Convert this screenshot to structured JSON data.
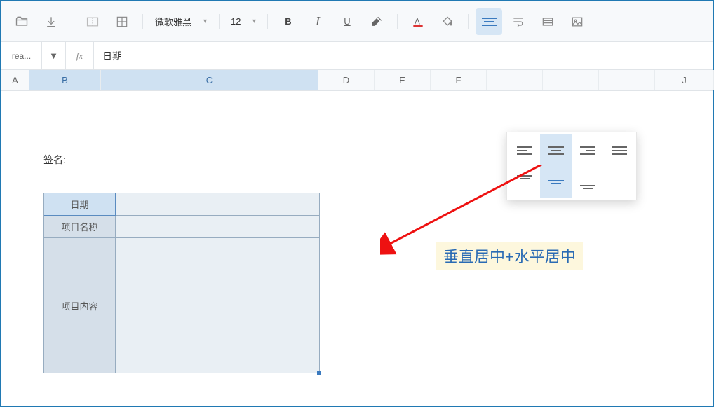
{
  "toolbar": {
    "font_name": "微软雅黑",
    "font_size": "12"
  },
  "formula": {
    "namebox": "rea...",
    "fx_label": "fx",
    "value": "日期"
  },
  "columns": [
    "A",
    "B",
    "C",
    "D",
    "E",
    "F",
    "J"
  ],
  "sheet": {
    "signature_label": "签名:",
    "table": {
      "row1_header": "日期",
      "row2_header": "项目名称",
      "row3_header": "项目内容"
    }
  },
  "annotation": "垂直居中+水平居中"
}
